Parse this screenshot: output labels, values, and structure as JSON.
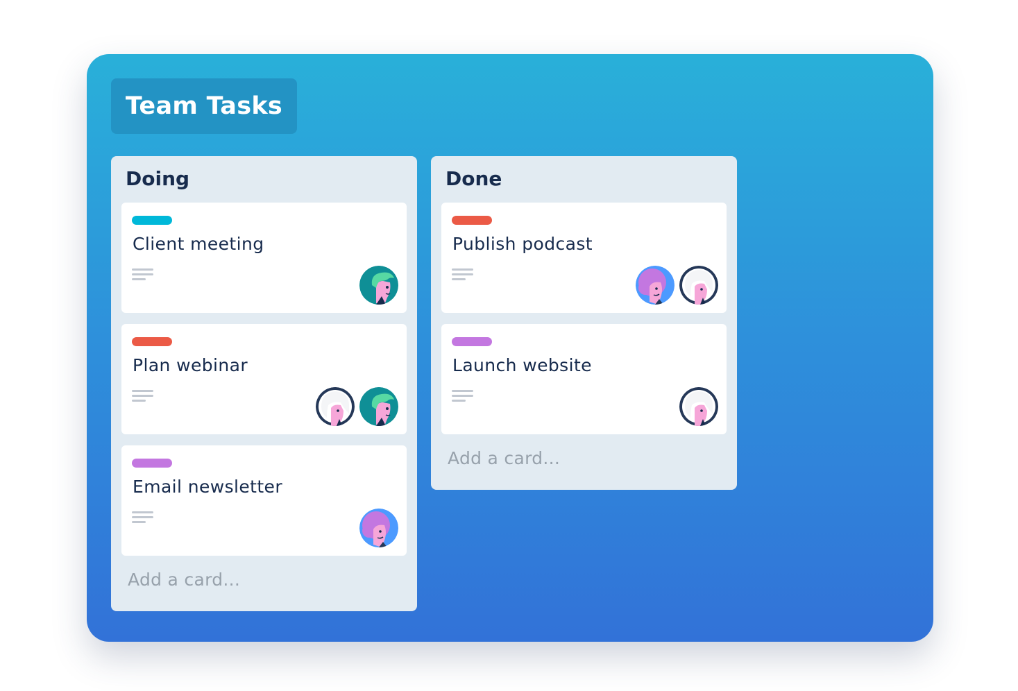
{
  "board": {
    "title": "Team Tasks"
  },
  "colors": {
    "label_cyan": "#00b8d9",
    "label_red": "#eb5a46",
    "label_purple": "#c377e0"
  },
  "lists": [
    {
      "title": "Doing",
      "add_card": "Add a card...",
      "cards": [
        {
          "title": "Client meeting",
          "label_color": "#00b8d9",
          "avatars": [
            "avatar-green-hair"
          ]
        },
        {
          "title": "Plan webinar",
          "label_color": "#eb5a46",
          "avatars": [
            "avatar-white-hair",
            "avatar-green-hair"
          ]
        },
        {
          "title": "Email newsletter",
          "label_color": "#c377e0",
          "avatars": [
            "avatar-purple-hair"
          ]
        }
      ]
    },
    {
      "title": "Done",
      "add_card": "Add a card...",
      "cards": [
        {
          "title": "Publish podcast",
          "label_color": "#eb5a46",
          "avatars": [
            "avatar-purple-hair",
            "avatar-white-hair"
          ]
        },
        {
          "title": "Launch website",
          "label_color": "#c377e0",
          "avatars": [
            "avatar-white-hair"
          ]
        }
      ]
    }
  ]
}
